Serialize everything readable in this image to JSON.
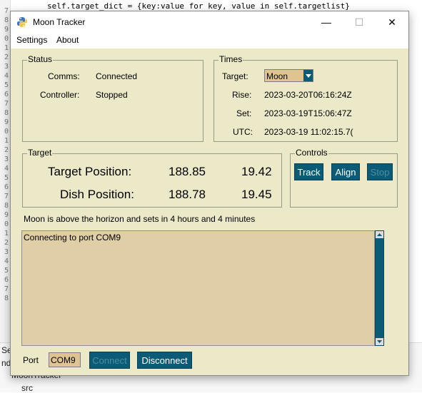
{
  "background": {
    "code_line": "self.target_dict = {key:value for key, value in self.targetlist}",
    "line_numbers": [
      "7",
      "8",
      "9",
      "0",
      "1",
      "2",
      "3",
      "4",
      "5",
      "6",
      "7",
      "8",
      "9",
      "0",
      "1",
      "2",
      "3",
      "4",
      "5",
      "6",
      "7",
      "8",
      "9",
      "0",
      "1",
      "2",
      "3",
      "4",
      "5",
      "6",
      "7",
      "8"
    ],
    "tree_items": [
      "Sea",
      "ndo",
      "MoonTracker",
      "src"
    ]
  },
  "window": {
    "title": "Moon Tracker",
    "menu": [
      "Settings",
      "About"
    ],
    "minimize": "—",
    "maximize": "☐",
    "close": "✕"
  },
  "status": {
    "title": "Status",
    "comms_label": "Comms:",
    "comms_value": "Connected",
    "controller_label": "Controller:",
    "controller_value": "Stopped"
  },
  "times": {
    "title": "Times",
    "target_label": "Target:",
    "target_value": "Moon",
    "rise_label": "Rise:",
    "rise_value": "2023-03-20T06:16:24Z",
    "set_label": "Set:",
    "set_value": "2023-03-19T15:06:47Z",
    "utc_label": "UTC:",
    "utc_value": "2023-03-19 11:02:15.7("
  },
  "target": {
    "title": "Target",
    "target_position_label": "Target Position:",
    "target_az": "188.85",
    "target_el": "19.42",
    "dish_position_label": "Dish Position:",
    "dish_az": "188.78",
    "dish_el": "19.45"
  },
  "controls": {
    "title": "Controls",
    "track": "Track",
    "align": "Align",
    "stop": "Stop"
  },
  "message": "Moon is above the horizon and sets in 4 hours and 4 minutes",
  "log": {
    "text": "Connecting to port COM9"
  },
  "bottom": {
    "port_label": "Port",
    "port_value": "COM9",
    "connect": "Connect",
    "disconnect": "Disconnect"
  },
  "colors": {
    "window_bg": "#ece9c8",
    "button_bg": "#0b5b76",
    "field_bg": "#e0c490",
    "log_bg": "#e0cfa6"
  }
}
